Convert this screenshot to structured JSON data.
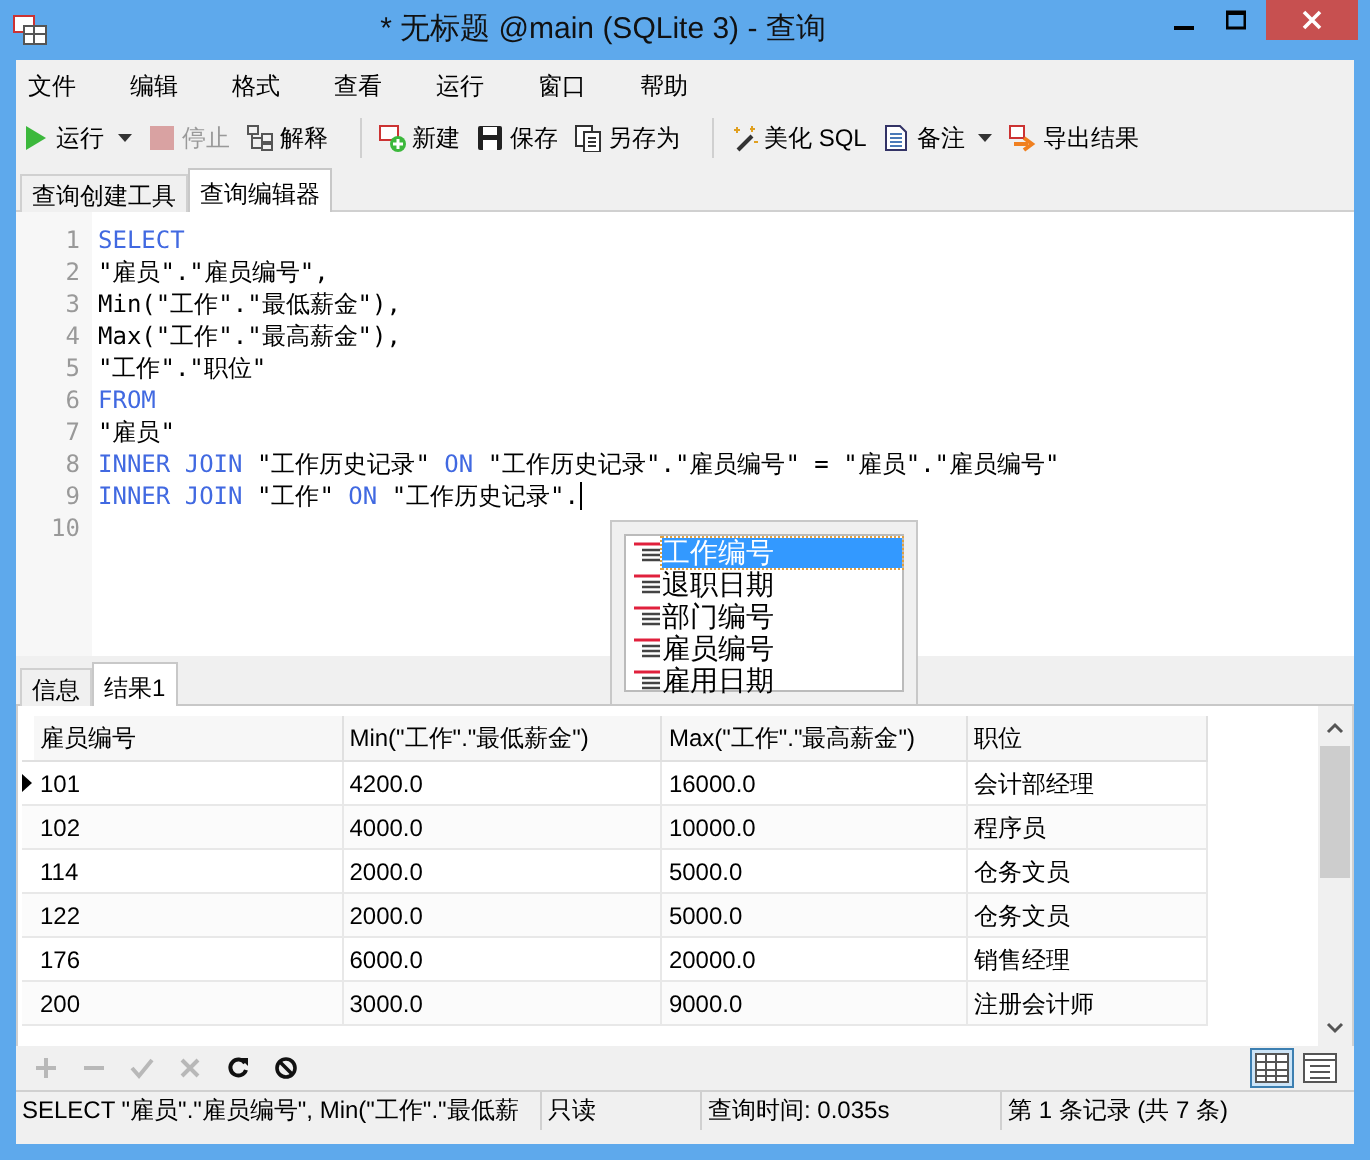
{
  "window": {
    "title": "* 无标题 @main (SQLite 3) - 查询"
  },
  "menu": [
    "文件",
    "编辑",
    "格式",
    "查看",
    "运行",
    "窗口",
    "帮助"
  ],
  "toolbar": [
    [
      {
        "label": "运行",
        "disabled": false,
        "dropdown": true
      },
      {
        "label": "停止",
        "disabled": true,
        "dropdown": false
      },
      {
        "label": "解释",
        "disabled": false,
        "dropdown": false
      }
    ],
    [
      {
        "label": "新建",
        "disabled": false,
        "dropdown": false
      },
      {
        "label": "保存",
        "disabled": false,
        "dropdown": false
      },
      {
        "label": "另存为",
        "disabled": false,
        "dropdown": false
      }
    ],
    [
      {
        "label": "美化 SQL",
        "disabled": false,
        "dropdown": false
      },
      {
        "label": "备注",
        "disabled": false,
        "dropdown": true
      },
      {
        "label": "导出结果",
        "disabled": false,
        "dropdown": false
      }
    ]
  ],
  "editor_tabs": [
    {
      "label": "查询创建工具",
      "selected": false
    },
    {
      "label": "查询编辑器",
      "selected": true
    }
  ],
  "editor": {
    "lines": [
      {
        "number": "1",
        "tokens": [
          {
            "kind": "keyword",
            "text": "SELECT"
          }
        ]
      },
      {
        "number": "2",
        "tokens": [
          {
            "kind": "text",
            "text": "\"雇员\".\"雇员编号\","
          }
        ]
      },
      {
        "number": "3",
        "tokens": [
          {
            "kind": "text",
            "text": "Min(\"工作\".\"最低薪金\"),"
          }
        ]
      },
      {
        "number": "4",
        "tokens": [
          {
            "kind": "text",
            "text": "Max(\"工作\".\"最高薪金\"),"
          }
        ]
      },
      {
        "number": "5",
        "tokens": [
          {
            "kind": "text",
            "text": "\"工作\".\"职位\""
          }
        ]
      },
      {
        "number": "6",
        "tokens": [
          {
            "kind": "keyword",
            "text": "FROM"
          }
        ]
      },
      {
        "number": "7",
        "tokens": [
          {
            "kind": "text",
            "text": "\"雇员\""
          }
        ]
      },
      {
        "number": "8",
        "tokens": [
          {
            "kind": "keyword",
            "text": "INNER JOIN"
          },
          {
            "kind": "text",
            "text": " \"工作历史记录\" "
          },
          {
            "kind": "keyword",
            "text": "ON"
          },
          {
            "kind": "text",
            "text": " \"工作历史记录\".\"雇员编号\" = \"雇员\".\"雇员编号\""
          }
        ]
      },
      {
        "number": "9",
        "tokens": [
          {
            "kind": "keyword",
            "text": "INNER JOIN"
          },
          {
            "kind": "text",
            "text": " \"工作\" "
          },
          {
            "kind": "keyword",
            "text": "ON"
          },
          {
            "kind": "text",
            "text": " \"工作历史记录\"."
          }
        ],
        "caret": true
      },
      {
        "number": "10"
      }
    ]
  },
  "autocomplete": [
    {
      "label": "工作编号",
      "selected": true
    },
    {
      "label": "退职日期",
      "selected": false
    },
    {
      "label": "部门编号",
      "selected": false
    },
    {
      "label": "雇员编号",
      "selected": false
    },
    {
      "label": "雇用日期",
      "selected": false
    }
  ],
  "result_tabs": [
    {
      "label": "信息",
      "selected": false
    },
    {
      "label": "结果1",
      "selected": true
    }
  ],
  "table": {
    "columns": [
      "雇员编号",
      "Min(\"工作\".\"最低薪金\")",
      "Max(\"工作\".\"最高薪金\")",
      "职位"
    ],
    "rows": [
      {
        "current": true,
        "cells": [
          "101",
          "4200.0",
          "16000.0",
          "会计部经理"
        ]
      },
      {
        "current": false,
        "cells": [
          "102",
          "4000.0",
          "10000.0",
          "程序员"
        ]
      },
      {
        "current": false,
        "cells": [
          "114",
          "2000.0",
          "5000.0",
          "仓务文员"
        ]
      },
      {
        "current": false,
        "cells": [
          "122",
          "2000.0",
          "5000.0",
          "仓务文员"
        ]
      },
      {
        "current": false,
        "cells": [
          "176",
          "6000.0",
          "20000.0",
          "销售经理"
        ]
      },
      {
        "current": false,
        "cells": [
          "200",
          "3000.0",
          "9000.0",
          "注册会计师"
        ]
      }
    ]
  },
  "grid_toolbar": {
    "actions": [
      {
        "disabled": true
      },
      {
        "disabled": true
      },
      {
        "disabled": true
      },
      {
        "disabled": true
      },
      {
        "disabled": false
      },
      {
        "disabled": false
      }
    ],
    "views": [
      {
        "selected": true
      },
      {
        "selected": false
      }
    ]
  },
  "status_bar": [
    "SELECT \"雇员\".\"雇员编号\", Min(\"工作\".\"最低薪",
    "只读",
    "查询时间: 0.035s",
    "第 1 条记录 (共 7 条)"
  ]
}
